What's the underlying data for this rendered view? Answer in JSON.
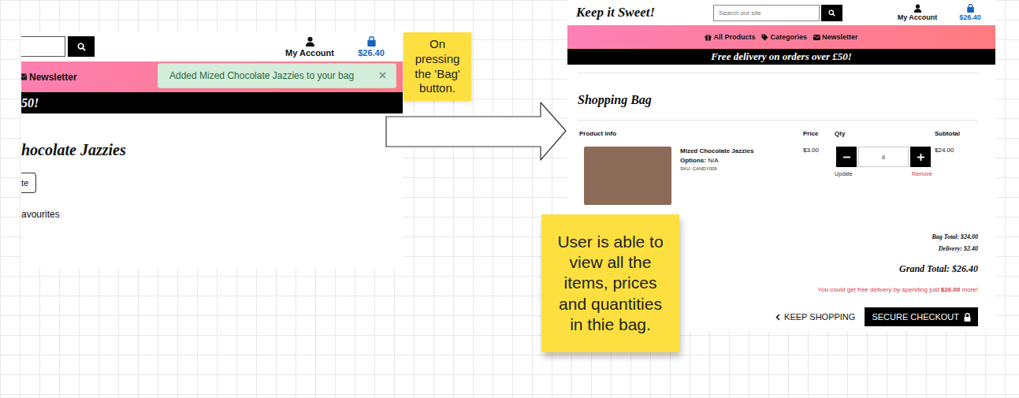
{
  "left_screenshot": {
    "account_label": "My Account",
    "bag_total": "$26.40",
    "nav_label": "Newsletter",
    "toast": {
      "message": "Added Mized Chocolate Jazzies to your bag",
      "close": "×"
    },
    "banner": "50!",
    "product_title": "hocolate Jazzies",
    "button_label": "te",
    "link_label": "avourites"
  },
  "note_1": "On pressing the 'Bag' button.",
  "right_screenshot": {
    "logo": "Keep it Sweet!",
    "search": {
      "placeholder": "Search our site"
    },
    "account_label": "My Account",
    "bag_total": "$26.40",
    "nav_items": [
      "All Products",
      "Categories",
      "Newsletter"
    ],
    "banner": "Free delivery on orders over £50!",
    "title": "Shopping Bag",
    "columns": [
      "Product Info",
      "Price",
      "Qty",
      "Subtotal"
    ],
    "rows": [
      {
        "name": "Mized Chocolate Jazzies",
        "options_label": "Options:",
        "options_value": "N/A",
        "sku": "SKU: CANDY009",
        "price": "$3.00",
        "quantity": "8",
        "subtotal": "$24.00",
        "update": "Update",
        "remove": "Remove"
      }
    ],
    "totals": {
      "bag_total": "Bag Total: $24.00",
      "delivery": "Delivery: $2.40",
      "grand_total": "Grand Total: $26.40"
    },
    "free_delivery": {
      "before": "You could get free delivery by spending just ",
      "amount": "$26.00",
      "after": " more!"
    },
    "buttons": [
      "KEEP SHOPPING",
      "SECURE CHECKOUT"
    ]
  },
  "note_2": "User is able to view all the items, prices and quantities in thie bag."
}
